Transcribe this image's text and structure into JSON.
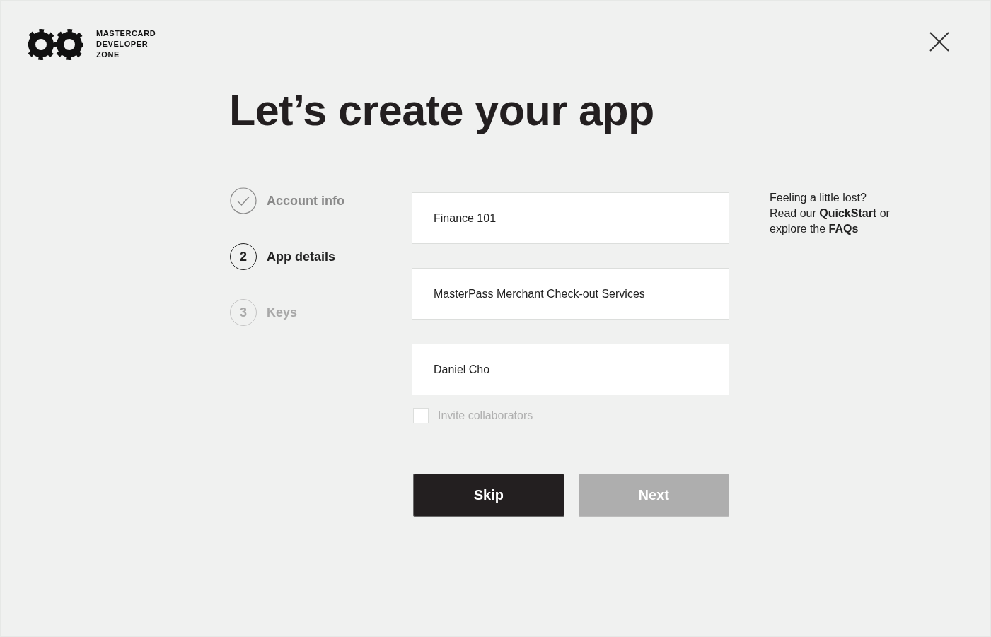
{
  "header": {
    "brand": "MASTERCARD DEVELOPER ZONE"
  },
  "title": "Let’s create your app",
  "steps": [
    {
      "label": "Account info",
      "completed": true,
      "selected": false
    },
    {
      "number": "2",
      "label": "App details",
      "completed": false,
      "selected": true
    },
    {
      "number": "3",
      "label": "Keys",
      "completed": false,
      "selected": false
    }
  ],
  "fields": [
    {
      "value": "Finance 101"
    },
    {
      "value": "MasterPass Merchant Check-out Services"
    },
    {
      "value": "Daniel Cho"
    }
  ],
  "invite": {
    "label": "Invite collaborators",
    "checked": false,
    "disabled": true
  },
  "buttons": [
    {
      "label": "Skip",
      "disabled": false
    },
    {
      "label": "Next",
      "disabled": true
    }
  ],
  "help": {
    "question": "Feeling a little lost?",
    "segments": [
      {
        "kind": "text",
        "text": "Read our "
      },
      {
        "kind": "link",
        "text": "QuickStart"
      },
      {
        "kind": "text",
        "text": " or explore the "
      },
      {
        "kind": "link",
        "text": "FAQs"
      }
    ]
  }
}
